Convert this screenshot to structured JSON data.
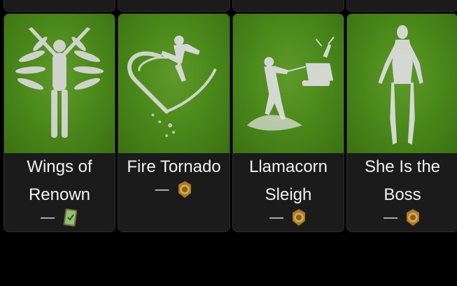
{
  "items": [
    {
      "title_line1": "Wings of",
      "title_line2": "Renown",
      "price": "—",
      "currency_icon": "card-currency-icon"
    },
    {
      "title_line1": "Fire Tornado",
      "title_line2": "",
      "price": "—",
      "currency_icon": "medal-currency-icon"
    },
    {
      "title_line1": "Llamacorn",
      "title_line2": "Sleigh",
      "price": "—",
      "currency_icon": "medal-currency-icon"
    },
    {
      "title_line1": "She Is the",
      "title_line2": "Boss",
      "price": "—",
      "currency_icon": "medal-currency-icon"
    }
  ],
  "colors": {
    "thumb_green": "#4c8a1c",
    "card_bg": "#1b1b1b",
    "page_bg": "#000000"
  }
}
